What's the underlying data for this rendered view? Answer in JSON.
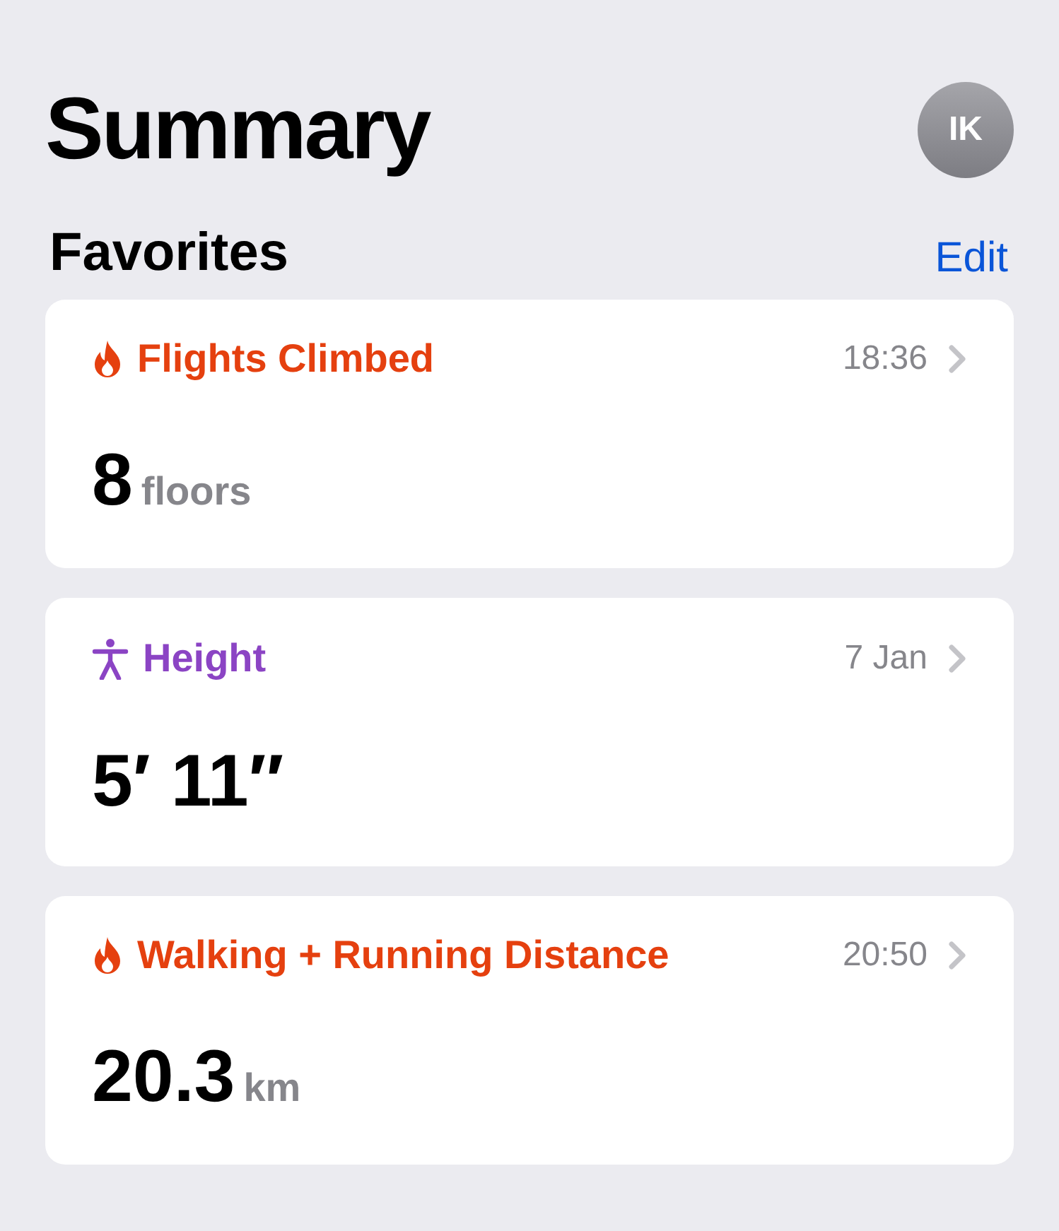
{
  "header": {
    "title": "Summary",
    "avatar": "IK"
  },
  "section": {
    "title": "Favorites",
    "action": "Edit"
  },
  "cards": [
    {
      "kind": "activity",
      "color": "#e5400f",
      "title": "Flights Climbed",
      "time": "18:36",
      "value": "8",
      "unit": "floors"
    },
    {
      "kind": "body",
      "color": "#8b44c4",
      "title": "Height",
      "time": "7 Jan",
      "value": "5′ 11″"
    },
    {
      "kind": "activity",
      "color": "#e5400f",
      "title": "Walking + Running Distance",
      "time": "20:50",
      "value": "20.3",
      "unit": "km"
    }
  ]
}
